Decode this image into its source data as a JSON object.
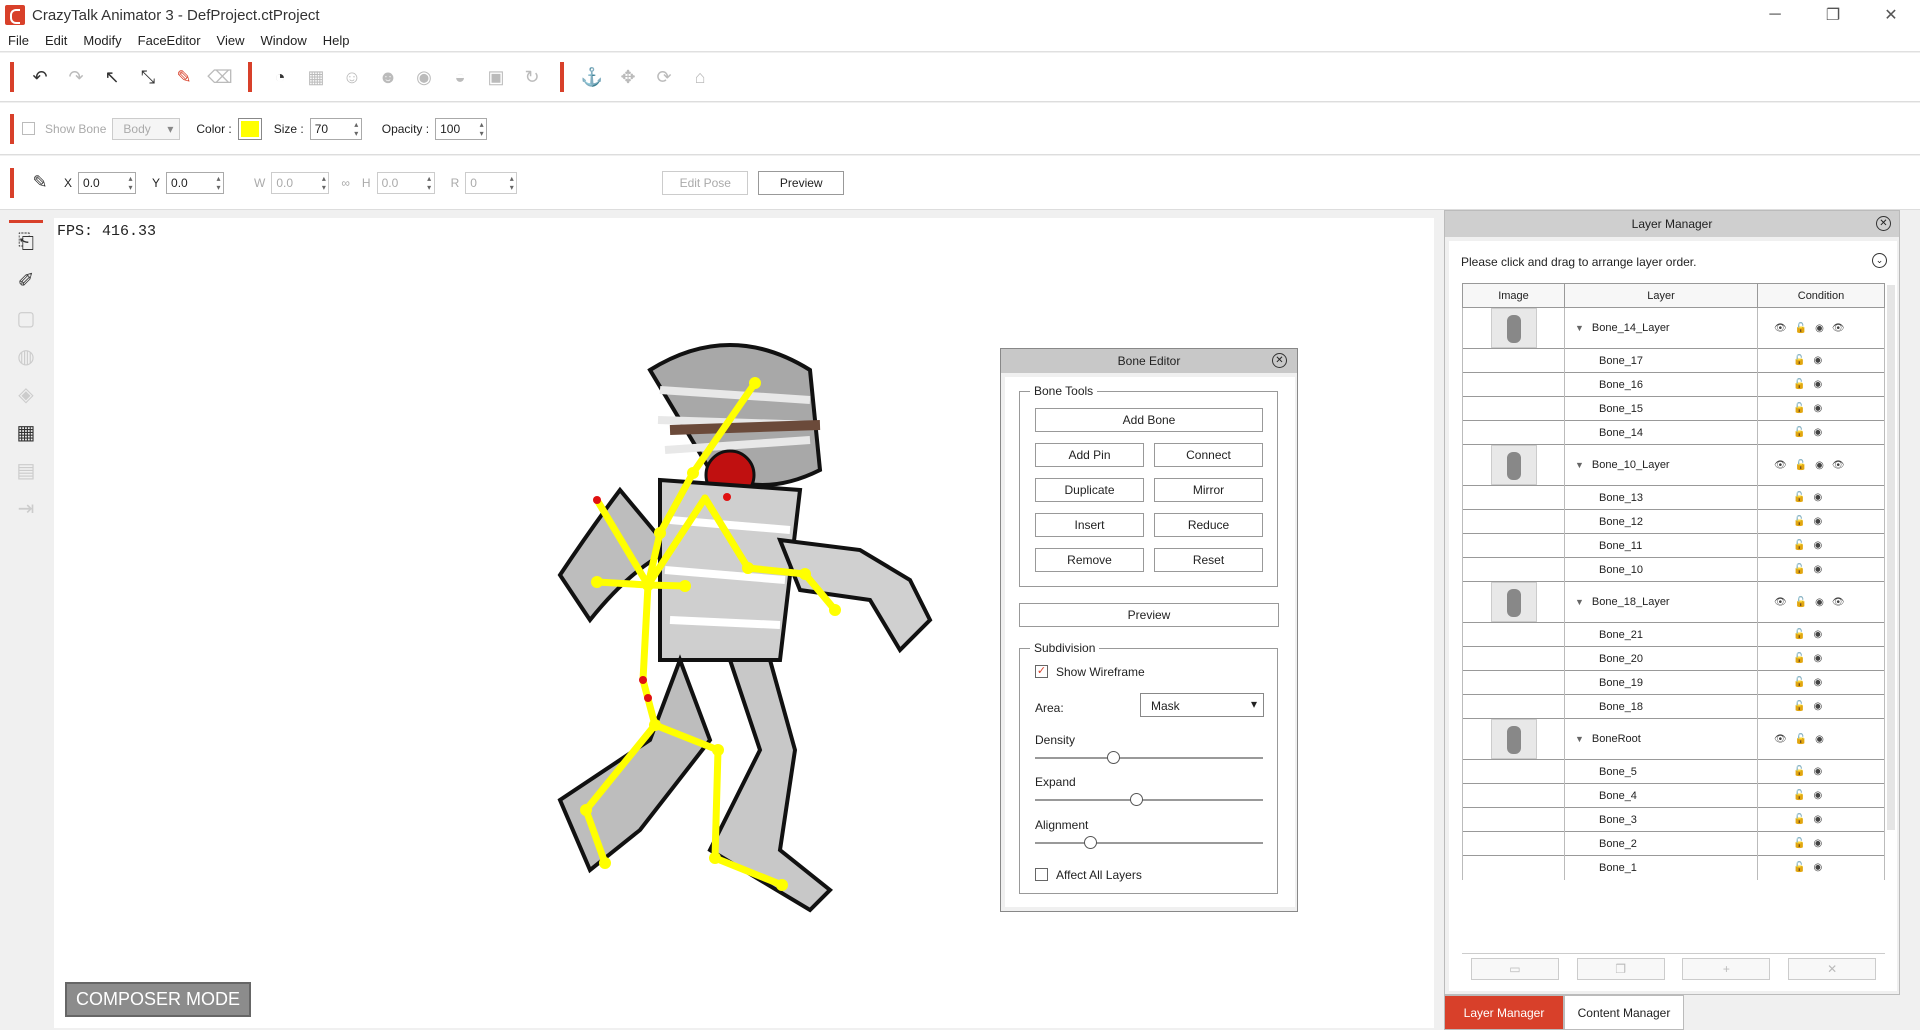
{
  "window": {
    "title": "CrazyTalk Animator 3   - DefProject.ctProject",
    "minimize": "─",
    "maximize": "❐",
    "close": "✕"
  },
  "menu": [
    "File",
    "Edit",
    "Modify",
    "FaceEditor",
    "View",
    "Window",
    "Help"
  ],
  "toolbar2": {
    "show_bone": "Show Bone",
    "body_dropdown": "Body",
    "color_label": "Color :",
    "color_value": "#ffff00",
    "size_label": "Size :",
    "size_value": "70",
    "opacity_label": "Opacity :",
    "opacity_value": "100"
  },
  "toolbar3": {
    "x_label": "X",
    "x_value": "0.0",
    "y_label": "Y",
    "y_value": "0.0",
    "w_label": "W",
    "w_value": "0.0",
    "h_label": "H",
    "h_value": "0.0",
    "r_label": "R",
    "r_value": "0",
    "edit_pose": "Edit Pose",
    "preview": "Preview"
  },
  "stage": {
    "fps": "FPS: 416.33",
    "composer_mode": "COMPOSER MODE"
  },
  "bone_editor": {
    "title": "Bone Editor",
    "bone_tools_label": "Bone Tools",
    "add_bone": "Add Bone",
    "add_pin": "Add Pin",
    "connect": "Connect",
    "duplicate": "Duplicate",
    "mirror": "Mirror",
    "insert": "Insert",
    "reduce": "Reduce",
    "remove": "Remove",
    "reset": "Reset",
    "preview": "Preview",
    "subdivision_label": "Subdivision",
    "show_wireframe": "Show Wireframe",
    "area_label": "Area:",
    "area_value": "Mask",
    "density_label": "Density",
    "density_value": 0.35,
    "expand_label": "Expand",
    "expand_value": 0.45,
    "alignment_label": "Alignment",
    "alignment_value": 0.24,
    "affect_all_layers": "Affect All  Layers"
  },
  "layer_manager": {
    "title": "Layer Manager",
    "hint": "Please click and drag to arrange layer order.",
    "col_image": "Image",
    "col_layer": "Layer",
    "col_condition": "Condition",
    "layers": [
      {
        "name": "Bone_14_Layer",
        "group": true
      },
      {
        "name": "Bone_17"
      },
      {
        "name": "Bone_16"
      },
      {
        "name": "Bone_15"
      },
      {
        "name": "Bone_14"
      },
      {
        "name": "Bone_10_Layer",
        "group": true
      },
      {
        "name": "Bone_13"
      },
      {
        "name": "Bone_12"
      },
      {
        "name": "Bone_11"
      },
      {
        "name": "Bone_10"
      },
      {
        "name": "Bone_18_Layer",
        "group": true
      },
      {
        "name": "Bone_21"
      },
      {
        "name": "Bone_20"
      },
      {
        "name": "Bone_19"
      },
      {
        "name": "Bone_18"
      },
      {
        "name": "BoneRoot",
        "group": true
      },
      {
        "name": "Bone_5"
      },
      {
        "name": "Bone_4"
      },
      {
        "name": "Bone_3"
      },
      {
        "name": "Bone_2"
      },
      {
        "name": "Bone_1"
      }
    ]
  },
  "tabs": {
    "layer_manager": "Layer Manager",
    "content_manager": "Content Manager"
  }
}
